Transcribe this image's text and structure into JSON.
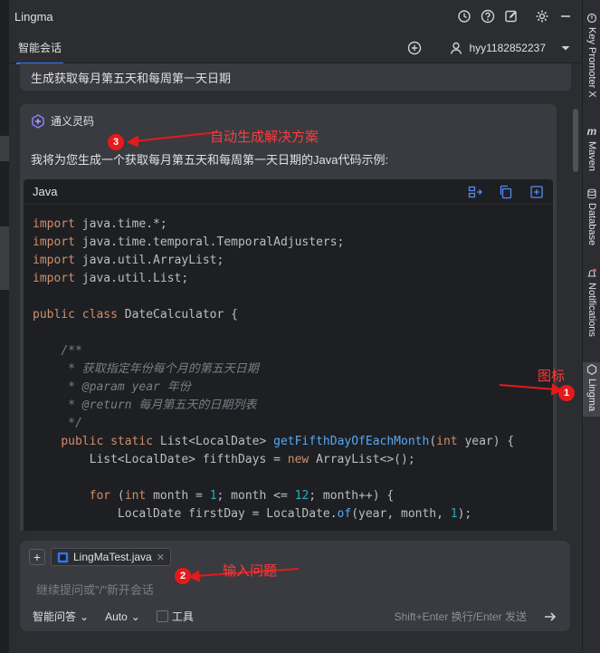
{
  "window": {
    "title": "Lingma"
  },
  "tabs": {
    "active_label": "智能会话"
  },
  "user": {
    "name": "hyy1182852237"
  },
  "conversation": {
    "user_message": "生成获取每月第五天和每周第一天日期",
    "ai_name": "通义灵码",
    "ai_intro": "我将为您生成一个获取每月第五天和每周第一天日期的Java代码示例:",
    "code_lang": "Java"
  },
  "input": {
    "file_chip": "LingMaTest.java",
    "placeholder": "继续提问或\"/\"新开会话",
    "mode": "智能问答",
    "model": "Auto",
    "tools_label": "工具",
    "hint": "Shift+Enter 换行/Enter 发送"
  },
  "right_tabs": [
    "Key Promoter X",
    "Maven",
    "Database",
    "Notifications",
    "Lingma"
  ],
  "annotations": {
    "a1_label": "图标",
    "a1_num": "1",
    "a2_label": "输入问题",
    "a2_num": "2",
    "a3_label": "自动生成解决方案",
    "a3_num": "3"
  }
}
